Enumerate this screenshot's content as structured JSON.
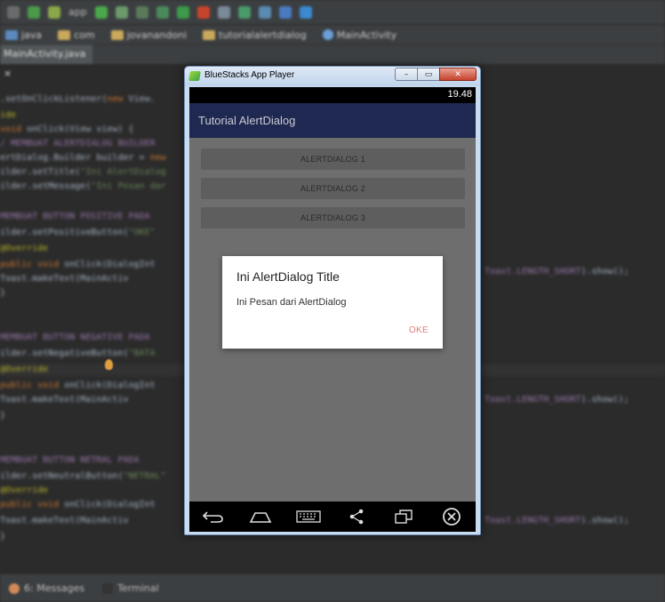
{
  "ide": {
    "run_config": "app",
    "breadcrumbs": [
      "java",
      "com",
      "jovanandoni",
      "tutorialalertdialog",
      "MainActivity"
    ],
    "editor_tab": "MainActivity.java",
    "bottom_tools": [
      "6: Messages",
      "Terminal"
    ]
  },
  "window": {
    "title": "BlueStacks App Player",
    "buttons": {
      "minimize": "–",
      "maximize": "▭",
      "close": "✕"
    }
  },
  "device": {
    "status_time": "19.48",
    "app_title": "Tutorial AlertDialog",
    "buttons": [
      "ALERTDIALOG 1",
      "ALERTDIALOG 2",
      "ALERTDIALOG 3"
    ]
  },
  "dialog": {
    "title": "Ini AlertDialog Title",
    "message": "Ini Pesan dari AlertDialog",
    "positive_button": "OKE"
  },
  "nav_icons": [
    "back-icon",
    "home-icon",
    "keyboard-icon",
    "share-icon",
    "recent-apps-icon",
    "close-circle-icon"
  ],
  "colors": {
    "action_bar": "#1e2850",
    "content_bg": "#6e6e6e",
    "dialog_button": "#e07a7a"
  }
}
